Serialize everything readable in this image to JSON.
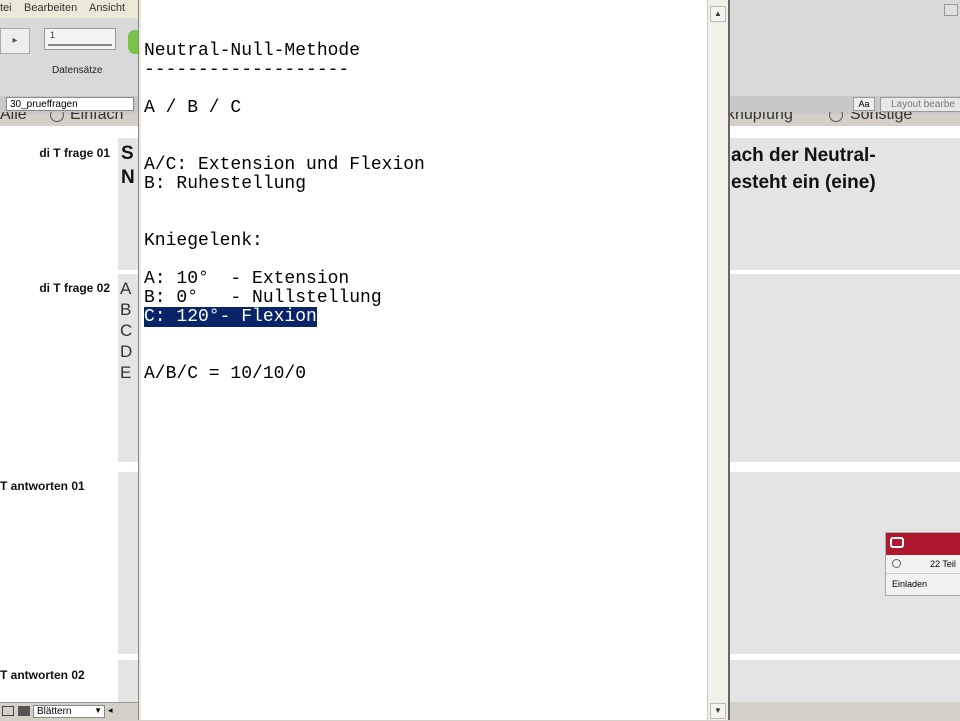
{
  "app": {
    "menu": [
      "tei",
      "Bearbeiten",
      "Ansicht"
    ],
    "records_label": "Datensätze",
    "record_number": "1",
    "database_name": "30_prueffragen",
    "aa_label": "Aa",
    "layout_button": "Layout bearbe",
    "radio_row": {
      "left_all": "Alle",
      "left_option": "Einfach",
      "right_option1": "knüpfung",
      "right_option2": "Sonstige"
    },
    "fields": [
      {
        "label": "di T frage 01"
      },
      {
        "label": "di T frage 02"
      },
      {
        "label": "T antworten 01"
      },
      {
        "label": "T antworten 02"
      }
    ],
    "frage01_left": "S\nN",
    "frage01_right": "ach der Neutral-\nesteht ein (eine)",
    "letters": [
      "A",
      "B",
      "C",
      "D",
      "E"
    ],
    "statusbar_mode": "Blättern",
    "panel": {
      "count_text": "22 Teil",
      "invite": "Einladen"
    }
  },
  "editor": {
    "lines": [
      {
        "text": "Neutral-Null-Methode"
      },
      {
        "text": "-------------------"
      },
      {
        "text": ""
      },
      {
        "text": "A / B / C"
      },
      {
        "text": ""
      },
      {
        "text": ""
      },
      {
        "text": "A/C: Extension und Flexion"
      },
      {
        "text": "B: Ruhestellung"
      },
      {
        "text": ""
      },
      {
        "text": ""
      },
      {
        "text": "Kniegelenk:"
      },
      {
        "text": ""
      },
      {
        "text": "A: 10°  - Extension"
      },
      {
        "text": "B: 0°   - Nullstellung"
      },
      {
        "text": "C: 120°- Flexion",
        "selected": true
      },
      {
        "text": ""
      },
      {
        "text": ""
      },
      {
        "text": "A/B/C = 10/10/0"
      }
    ]
  }
}
